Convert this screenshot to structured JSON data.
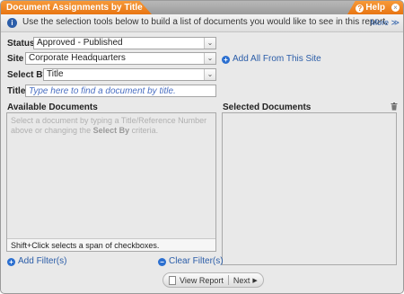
{
  "window": {
    "title": "Document Assignments by Title",
    "help_label": "Help",
    "close_glyph": "×",
    "info_text": "Use the selection tools below to build a list of documents you would like to see in this report.",
    "more_label": "More ≫"
  },
  "form": {
    "status": {
      "label": "Status",
      "value": "Approved - Published"
    },
    "site": {
      "label": "Site",
      "value": "Corporate Headquarters",
      "add_all_label": "Add All From This Site"
    },
    "select_by": {
      "label": "Select By",
      "value": "Title"
    },
    "title": {
      "label": "Title",
      "placeholder": "Type here to find a document by title."
    }
  },
  "available": {
    "heading": "Available Documents",
    "hint_before": "Select a document by typing a Title/Reference Number above or changing the ",
    "hint_bold": "Select By",
    "hint_after": " criteria.",
    "footer": "Shift+Click selects a span of checkboxes."
  },
  "selected": {
    "heading": "Selected Documents"
  },
  "filters": {
    "add_label": "Add Filter(s)",
    "clear_label": "Clear Filter(s)"
  },
  "actions": {
    "view_report_label": "View Report",
    "next_label": "Next"
  },
  "colors": {
    "accent_orange": "#e87512",
    "link_blue": "#2b5da8"
  },
  "icons": [
    "info-icon",
    "help-icon",
    "close-icon",
    "chevron-down-icon",
    "plus-icon",
    "minus-icon",
    "trash-icon",
    "document-icon",
    "play-right-icon"
  ]
}
